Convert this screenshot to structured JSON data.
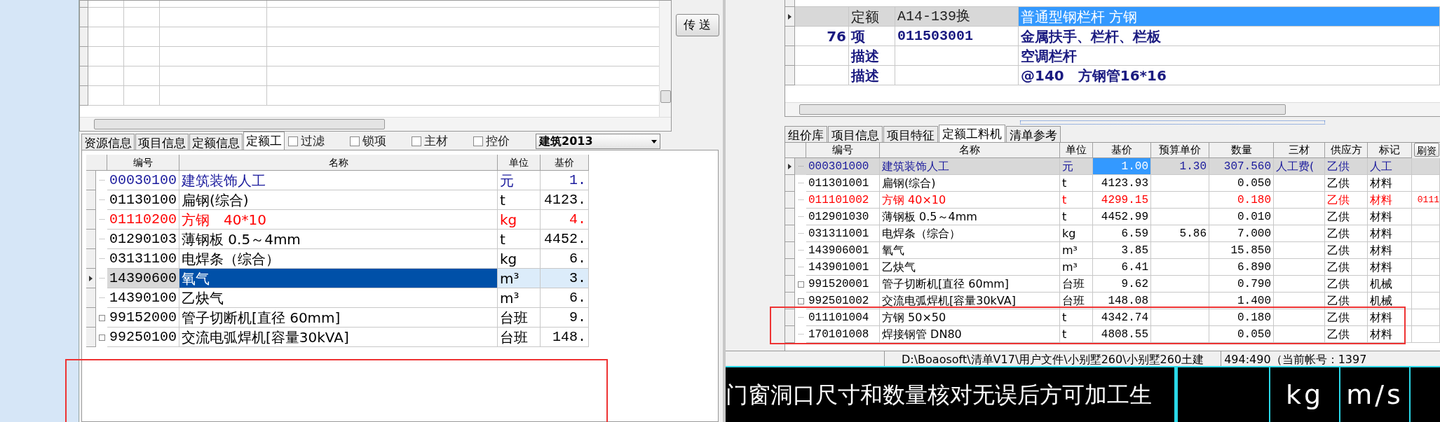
{
  "left_top": {
    "buttons": [
      "传 送"
    ]
  },
  "left_tabs": [
    {
      "label": "资源信息",
      "selected": false
    },
    {
      "label": "项目信息",
      "selected": false
    },
    {
      "label": "定额信息",
      "selected": false
    },
    {
      "label": "定额工",
      "selected": true
    }
  ],
  "filters": [
    {
      "label": "过滤",
      "checked": false
    },
    {
      "label": "锁项",
      "checked": false
    },
    {
      "label": "主材",
      "checked": false
    },
    {
      "label": "控价",
      "checked": false
    }
  ],
  "library_select": {
    "value": "建筑2013"
  },
  "left_grid": {
    "columns": [
      "编号",
      "名称",
      "单位",
      "基价"
    ],
    "rows": [
      {
        "code": "00030100",
        "name": "建筑装饰人工",
        "unit": "元",
        "price": "1.",
        "color": "#1a1a9c",
        "selected": false,
        "expandable": false
      },
      {
        "code": "01130100",
        "name": "扁钢(综合)",
        "unit": "t",
        "price": "4123.",
        "color": "#000000",
        "selected": false,
        "expandable": false
      },
      {
        "code": "01110200",
        "name": "方钢　40*10",
        "unit": "kg",
        "price": "4.",
        "color": "#ff0000",
        "selected": false,
        "expandable": false
      },
      {
        "code": "01290103",
        "name": "薄钢板 0.5～4mm",
        "unit": "t",
        "price": "4452.",
        "color": "#000000",
        "selected": false,
        "expandable": false
      },
      {
        "code": "03131100",
        "name": "电焊条（综合）",
        "unit": "kg",
        "price": "6.",
        "color": "#000000",
        "selected": false,
        "expandable": false
      },
      {
        "code": "14390600",
        "name": "氧气",
        "unit": "m³",
        "price": "3.",
        "color": "#000000",
        "selected": true,
        "expandable": false
      },
      {
        "code": "14390100",
        "name": "乙炔气",
        "unit": "m³",
        "price": "6.",
        "color": "#000000",
        "selected": false,
        "expandable": false
      },
      {
        "code": "99152000",
        "name": "管子切断机[直径 60mm]",
        "unit": "台班",
        "price": "9.",
        "color": "#000000",
        "selected": false,
        "expandable": true
      },
      {
        "code": "99250100",
        "name": "交流电弧焊机[容量30kVA]",
        "unit": "台班",
        "price": "148.",
        "color": "#000000",
        "selected": false,
        "expandable": true
      }
    ]
  },
  "right_top_grid": {
    "rows": [
      {
        "type": "定额",
        "code": "A14-139换",
        "name": "普通型钢栏杆 方钢",
        "selected": true
      },
      {
        "number": "76",
        "type": "项",
        "code": "011503001",
        "name": "金属扶手、栏杆、栏板",
        "selected": false
      },
      {
        "type": "描述",
        "name": "空调栏杆",
        "selected": false
      },
      {
        "type": "描述",
        "name": "@140　方钢管16*16",
        "selected": false
      }
    ]
  },
  "right_tabs": [
    {
      "label": "组价库",
      "selected": false
    },
    {
      "label": "项目信息",
      "selected": false
    },
    {
      "label": "项目特征",
      "selected": false
    },
    {
      "label": "定额工料机",
      "selected": true
    },
    {
      "label": "清单参考",
      "selected": false
    }
  ],
  "right_grid": {
    "columns": [
      "编号",
      "名称",
      "单位",
      "基价",
      "预算单价",
      "数量",
      "三材",
      "供应方",
      "标记"
    ],
    "refresh_button": "刷资",
    "rows": [
      {
        "code": "000301000",
        "name": "建筑装饰人工",
        "unit": "元",
        "base_price": "1.00",
        "budget_price": "1.30",
        "quantity": "307.560",
        "three_materials": "人工费(",
        "supplier": "乙供",
        "mark": "人工",
        "color": "#1a1a9c",
        "selected": true,
        "expandable": false
      },
      {
        "code": "011301001",
        "name": "扁钢(综合)",
        "unit": "t",
        "base_price": "4123.93",
        "quantity": "0.050",
        "supplier": "乙供",
        "mark": "材料",
        "color": "#000000",
        "selected": false,
        "expandable": false
      },
      {
        "code": "011101002",
        "name": "方钢 40×10",
        "unit": "t",
        "base_price": "4299.15",
        "quantity": "0.180",
        "supplier": "乙供",
        "mark": "材料",
        "column_12": "0111",
        "color": "#ff0000",
        "selected": false,
        "expandable": false
      },
      {
        "code": "012901030",
        "name": "薄钢板 0.5～4mm",
        "unit": "t",
        "base_price": "4452.99",
        "quantity": "0.010",
        "supplier": "乙供",
        "mark": "材料",
        "color": "#000000",
        "selected": false,
        "expandable": false
      },
      {
        "code": "031311001",
        "name": "电焊条（综合）",
        "unit": "kg",
        "base_price": "6.59",
        "budget_price": "5.86",
        "quantity": "7.000",
        "supplier": "乙供",
        "mark": "材料",
        "color": "#000000",
        "selected": false,
        "expandable": false
      },
      {
        "code": "143906001",
        "name": "氧气",
        "unit": "m³",
        "base_price": "3.85",
        "quantity": "15.850",
        "supplier": "乙供",
        "mark": "材料",
        "color": "#000000",
        "selected": false,
        "expandable": false
      },
      {
        "code": "143901001",
        "name": "乙炔气",
        "unit": "m³",
        "base_price": "6.41",
        "quantity": "6.890",
        "supplier": "乙供",
        "mark": "材料",
        "color": "#000000",
        "selected": false,
        "expandable": false
      },
      {
        "code": "991520001",
        "name": "管子切断机[直径 60mm]",
        "unit": "台班",
        "base_price": "9.62",
        "quantity": "0.790",
        "supplier": "乙供",
        "mark": "机械",
        "color": "#000000",
        "selected": false,
        "expandable": true
      },
      {
        "code": "992501002",
        "name": "交流电弧焊机[容量30kVA]",
        "unit": "台班",
        "base_price": "148.08",
        "quantity": "1.400",
        "supplier": "乙供",
        "mark": "机械",
        "color": "#000000",
        "selected": false,
        "expandable": true
      },
      {
        "code": "011101004",
        "name": "方钢 50×50",
        "unit": "t",
        "base_price": "4342.74",
        "quantity": "0.180",
        "supplier": "乙供",
        "mark": "材料",
        "color": "#000000",
        "selected": false,
        "expandable": false
      },
      {
        "code": "170101008",
        "name": "焊接钢管 DN80",
        "unit": "t",
        "base_price": "4808.55",
        "quantity": "0.050",
        "supplier": "乙供",
        "mark": "材料",
        "color": "#000000",
        "selected": false,
        "expandable": false
      }
    ]
  },
  "status_bar": {
    "path": "D:\\Boaosoft\\清单V17\\用户文件\\小别墅260\\小别墅260土建",
    "position": "494:490（当前帐号：1397"
  },
  "cad": {
    "text": "门窗洞口尺寸和数量核对无误后方可加工生",
    "units": [
      "kg",
      "m/s"
    ]
  }
}
